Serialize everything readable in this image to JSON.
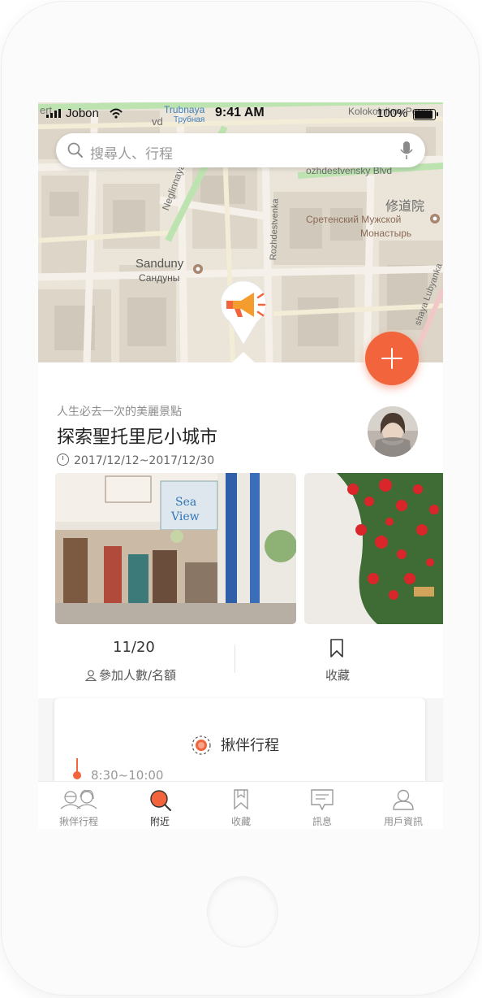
{
  "status_bar": {
    "carrier": "Jobon",
    "time": "9:41 AM",
    "battery": "100%"
  },
  "search": {
    "placeholder": "搜尋人、行程"
  },
  "map": {
    "labels": {
      "trubnaya": "Trubnaya",
      "trubnaya_ru": "Трубная",
      "kolokolnikov": "Kolokolnikov Pereu",
      "rozhdestvensky_blvd": "ozhdestvensky Blvd",
      "neglinnaya": "Neglinnaya St",
      "monastery_cn": "修道院",
      "monastery_ru_1": "Сретенский Мужской",
      "monastery_ru_2": "Монастырь",
      "rozhdestvenka": "Rozhdestvenka",
      "sanduny": "Sanduny",
      "sanduny_ru": "Сандуны",
      "lubyanka": "shaya Lubyanka",
      "vd": "vd"
    }
  },
  "trip": {
    "subtitle": "人生必去一次的美麗景點",
    "title": "探索聖托里尼小城市",
    "date_range": "2017/12/12~2017/12/30"
  },
  "stats": {
    "participants_value": "11/20",
    "participants_label": "參加人數/名額",
    "favorite_label": "收藏"
  },
  "itinerary": {
    "title": "揪伴行程",
    "first_time": "8:30~10:00"
  },
  "tabs": [
    {
      "label": "揪伴行程",
      "icon": "companions-icon",
      "active": false
    },
    {
      "label": "附近",
      "icon": "nearby-search-icon",
      "active": true
    },
    {
      "label": "收藏",
      "icon": "bookmark-icon",
      "active": false
    },
    {
      "label": "訊息",
      "icon": "message-icon",
      "active": false
    },
    {
      "label": "用戶資訊",
      "icon": "user-icon",
      "active": false
    }
  ],
  "colors": {
    "accent": "#f2643b",
    "map_road_green": "#bde3b1",
    "map_block": "#d9d3c7"
  }
}
